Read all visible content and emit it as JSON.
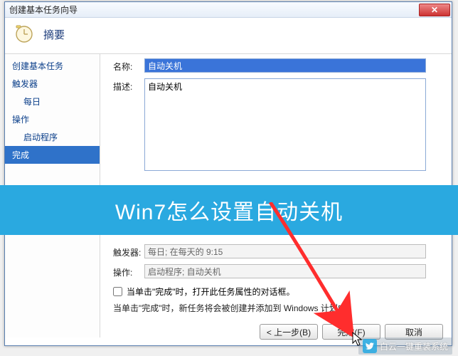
{
  "window": {
    "title": "创建基本任务向导",
    "close_label": "✕"
  },
  "header": {
    "title": "摘要"
  },
  "sidebar": {
    "items": [
      {
        "label": "创建基本任务",
        "sub": false,
        "active": false
      },
      {
        "label": "触发器",
        "sub": false,
        "active": false
      },
      {
        "label": "每日",
        "sub": true,
        "active": false
      },
      {
        "label": "操作",
        "sub": false,
        "active": false
      },
      {
        "label": "启动程序",
        "sub": true,
        "active": false
      },
      {
        "label": "完成",
        "sub": false,
        "active": true
      }
    ]
  },
  "fields": {
    "name_label": "名称:",
    "name_value": "自动关机",
    "desc_label": "描述:",
    "desc_value": "自动关机",
    "trigger_label": "触发器:",
    "trigger_value": "每日; 在每天的 9:15",
    "action_label": "操作:",
    "action_value": "启动程序; 自动关机"
  },
  "checkbox": {
    "label": "当单击\"完成\"时，打开此任务属性的对话框。",
    "checked": false
  },
  "note": "当单击\"完成\"时，新任务将会被创建并添加到 Windows 计划中。",
  "buttons": {
    "back": "< 上一步(B)",
    "finish": "完成(F)",
    "cancel": "取消"
  },
  "banner": "Win7怎么设置自动关机",
  "watermark": "白云一键重装系统"
}
